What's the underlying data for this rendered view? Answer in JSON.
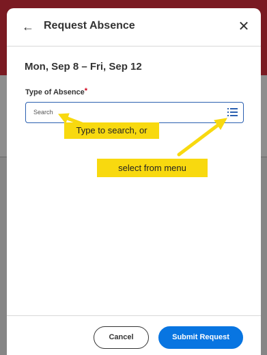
{
  "dialog": {
    "title": "Request Absence",
    "date_range": "Mon, Sep 8 – Fri, Sep 12"
  },
  "field": {
    "label": "Type of Absence",
    "required_marker": "*",
    "placeholder": "Search"
  },
  "annotations": {
    "callout_1": "Type to search, or",
    "callout_2": "select from menu"
  },
  "footer": {
    "cancel_label": "Cancel",
    "submit_label": "Submit Request"
  },
  "icons": {
    "back": "back-arrow-icon",
    "close": "close-icon",
    "menu": "list-menu-icon"
  },
  "colors": {
    "primary": "#0875e1",
    "focus_border": "#2a5fb0",
    "required": "#d0021b",
    "callout": "#f8d90f"
  }
}
